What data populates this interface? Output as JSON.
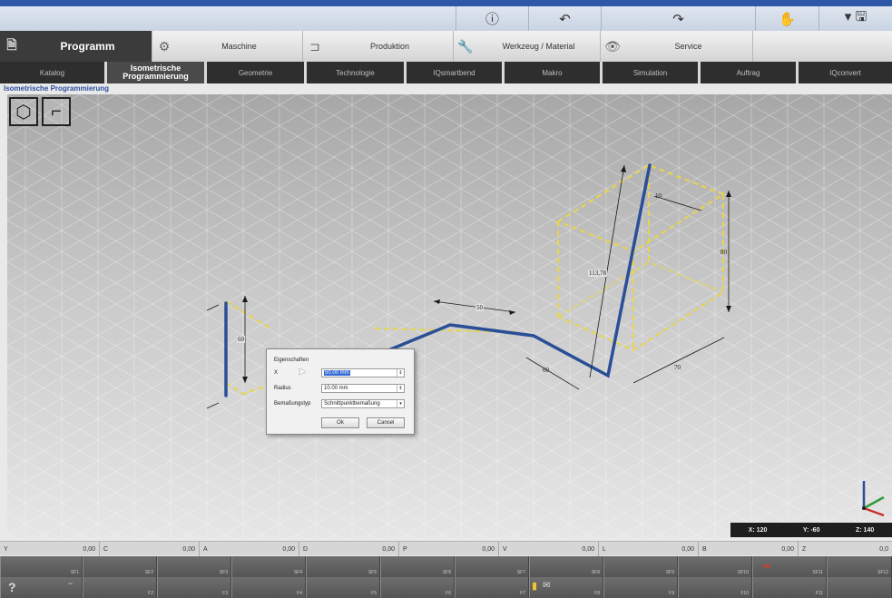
{
  "toolbar": {
    "buttons": [
      {
        "name": "info-button",
        "icon": "info-icon",
        "glyph": "ⓘ"
      },
      {
        "name": "undo-button",
        "icon": "undo-icon",
        "glyph": "↶"
      },
      {
        "name": "redo-button",
        "icon": "redo-icon",
        "glyph": "↷"
      },
      {
        "name": "touch-button",
        "icon": "hand-icon",
        "glyph": "✋"
      },
      {
        "name": "save-button",
        "icon": "save-icon",
        "glyph": "▾ 🖫"
      }
    ]
  },
  "main_tabs": [
    {
      "label": "Programm",
      "icon": "document-icon",
      "active": true
    },
    {
      "label": "Maschine",
      "icon": "gears-icon",
      "active": false
    },
    {
      "label": "Produktion",
      "icon": "bracket-icon",
      "active": false
    },
    {
      "label": "Werkzeug / Material",
      "icon": "wrench-icon",
      "active": false
    },
    {
      "label": "Service",
      "icon": "eye-icon",
      "active": false
    }
  ],
  "sub_tabs": [
    {
      "label": "Katalog",
      "active": false
    },
    {
      "label": "Isometrische Programmierung",
      "active": true
    },
    {
      "label": "Geometrie",
      "active": false
    },
    {
      "label": "Technologie",
      "active": false
    },
    {
      "label": "IQsmartbend",
      "active": false
    },
    {
      "label": "Makro",
      "active": false
    },
    {
      "label": "Simulation",
      "active": false
    },
    {
      "label": "Auftrag",
      "active": false
    },
    {
      "label": "IQconvert",
      "active": false
    }
  ],
  "view_title": "Isometrische Programmierung",
  "dimensions": {
    "d1": "60",
    "d2": "50",
    "d3": "60",
    "d4": "113,78",
    "d5": "80",
    "d6": "10",
    "d7": "70"
  },
  "coords": {
    "x": "X: 120",
    "y": "Y: -60",
    "z": "Z: 140"
  },
  "dialog": {
    "title": "Eigenschaften",
    "fields": [
      {
        "label": "X",
        "value": "50.00 mm",
        "selected": true
      },
      {
        "label": "Radius",
        "value": "10.00 mm",
        "selected": false
      },
      {
        "label": "Bemaßungstyp",
        "value": "Schnittpunktbemaßung",
        "selected": false
      }
    ],
    "ok_label": "Ok",
    "cancel_label": "Cancel"
  },
  "value_bar": [
    {
      "label": "Y",
      "value": "0,00"
    },
    {
      "label": "C",
      "value": "0,00"
    },
    {
      "label": "A",
      "value": "0,00"
    },
    {
      "label": "D",
      "value": "0,00"
    },
    {
      "label": "P",
      "value": "0,00"
    },
    {
      "label": "V",
      "value": "0,00"
    },
    {
      "label": "L",
      "value": "0,00"
    },
    {
      "label": "B",
      "value": "0,00"
    },
    {
      "label": "Z",
      "value": "0,0"
    }
  ],
  "softkeys_row1": [
    "SF1",
    "SF2",
    "SF3",
    "SF4",
    "SF5",
    "SF6",
    "SF7",
    "SF8",
    "SF9",
    "SF10",
    "SF11",
    "SF12"
  ],
  "softkeys_row2": [
    "",
    "F2",
    "F3",
    "F4",
    "F5",
    "F6",
    "F7",
    "F8",
    "F9",
    "F10",
    "F11",
    ""
  ],
  "colors": {
    "pipe": "#2a4f96",
    "ghost": "#e8d54a",
    "accent": "#2f57a8"
  }
}
